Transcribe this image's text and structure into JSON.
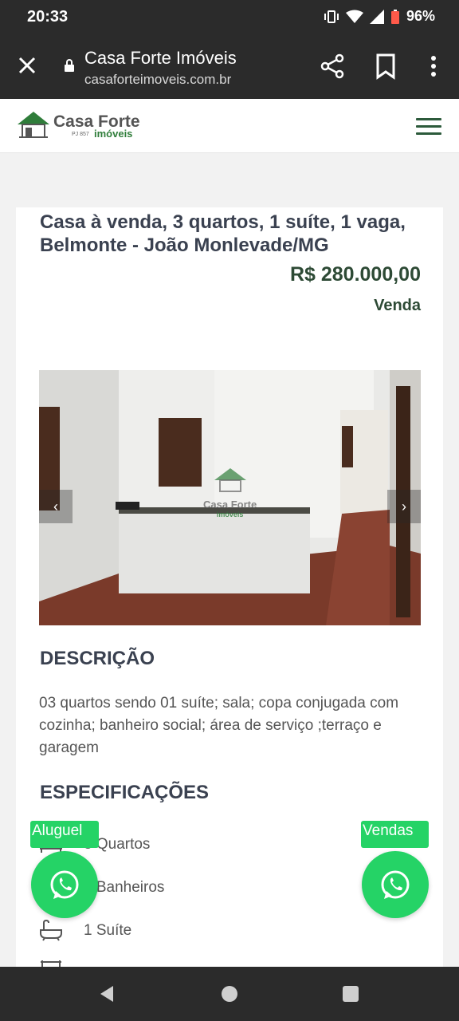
{
  "status_bar": {
    "time": "20:33",
    "battery": "96%"
  },
  "browser": {
    "page_title": "Casa Forte Imóveis",
    "url": "casaforteimoveis.com.br"
  },
  "header": {
    "logo_main": "Casa Forte",
    "logo_sub": "imóveis",
    "logo_pj": "PJ 857"
  },
  "listing": {
    "title": "Casa à venda, 3 quartos, 1 suíte, 1 vaga, Belmonte - João Monlevade/MG",
    "price": "R$ 280.000,00",
    "deal_type": "Venda",
    "photo_watermark": "Casa Forte",
    "photo_watermark_sub": "imóveis"
  },
  "description": {
    "heading": "DESCRIÇÃO",
    "text": "03 quartos sendo 01 suíte; sala; copa conjugada com cozinha; banheiro social; área de serviço ;terraço e garagem"
  },
  "specs": {
    "heading": "ESPECIFICAÇÕES",
    "items": [
      {
        "label": "3 Quartos",
        "icon": "bed-icon"
      },
      {
        "label": "2 Banheiros",
        "icon": "toilet-icon"
      },
      {
        "label": "1 Suíte",
        "icon": "bathtub-icon"
      },
      {
        "label": "",
        "icon": "area-icon"
      }
    ]
  },
  "whatsapp": {
    "left_label": "Aluguel",
    "right_label": "Vendas"
  },
  "colors": {
    "brand_green": "#2d4a35",
    "whatsapp": "#25d366",
    "heading": "#3a4150"
  }
}
